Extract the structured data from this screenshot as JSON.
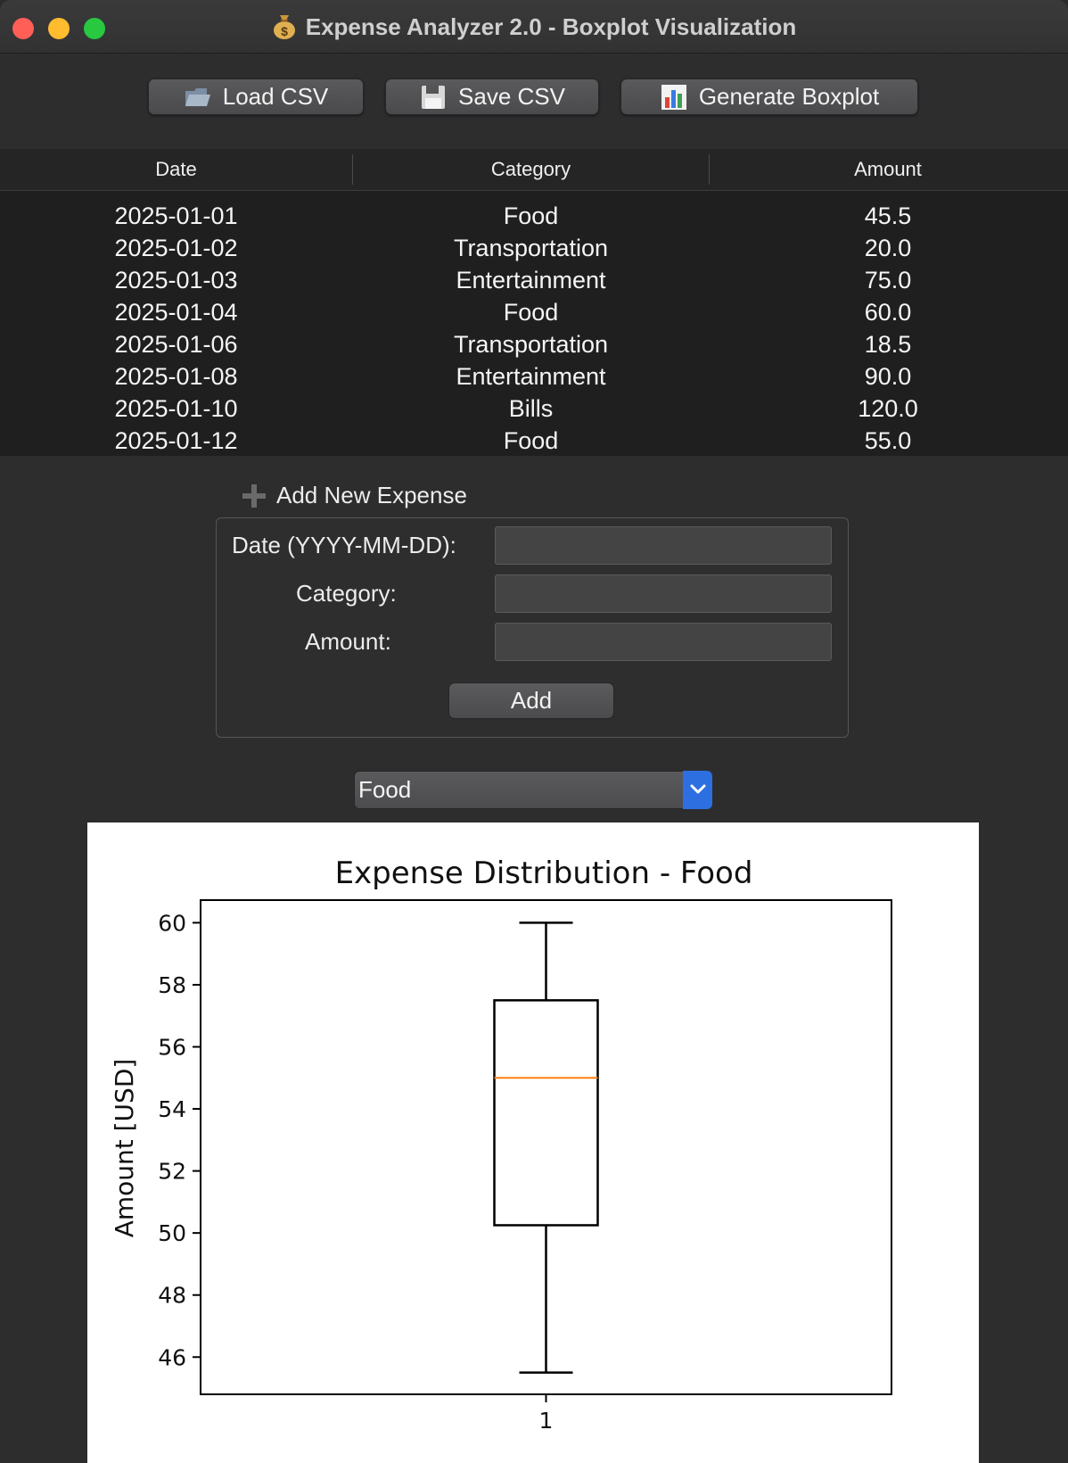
{
  "window": {
    "title": "Expense Analyzer 2.0 - Boxplot Visualization",
    "title_icon": "money-bag-icon"
  },
  "toolbar": {
    "load_label": "Load CSV",
    "save_label": "Save CSV",
    "generate_label": "Generate Boxplot"
  },
  "table": {
    "columns": [
      "Date",
      "Category",
      "Amount"
    ],
    "rows": [
      [
        "2025-01-01",
        "Food",
        "45.5"
      ],
      [
        "2025-01-02",
        "Transportation",
        "20.0"
      ],
      [
        "2025-01-03",
        "Entertainment",
        "75.0"
      ],
      [
        "2025-01-04",
        "Food",
        "60.0"
      ],
      [
        "2025-01-06",
        "Transportation",
        "18.5"
      ],
      [
        "2025-01-08",
        "Entertainment",
        "90.0"
      ],
      [
        "2025-01-10",
        "Bills",
        "120.0"
      ],
      [
        "2025-01-12",
        "Food",
        "55.0"
      ]
    ]
  },
  "form": {
    "section_title": "Add New Expense",
    "date_label": "Date (YYYY-MM-DD):",
    "category_label": "Category:",
    "amount_label": "Amount:",
    "date_value": "",
    "category_value": "",
    "amount_value": "",
    "add_label": "Add"
  },
  "category_select": {
    "selected": "Food"
  },
  "chart_data": {
    "type": "boxplot",
    "title": "Expense Distribution - Food",
    "xlabel": "",
    "ylabel": "Amount [USD]",
    "categories": [
      "1"
    ],
    "stats": [
      {
        "whislo": 45.5,
        "q1": 50.25,
        "med": 55.0,
        "q3": 57.5,
        "whishi": 60.0
      }
    ],
    "ylim": [
      44.8,
      60.73
    ],
    "yticks": [
      46,
      48,
      50,
      52,
      54,
      56,
      58,
      60
    ],
    "grid": false,
    "colors": {
      "box": "#000000",
      "median": "#ff7f0e"
    }
  }
}
